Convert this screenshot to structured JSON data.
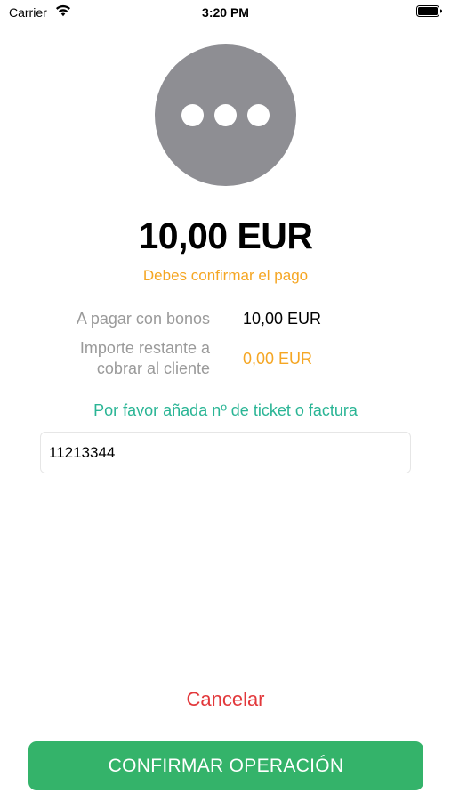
{
  "status_bar": {
    "carrier": "Carrier",
    "time": "3:20 PM",
    "icons": [
      "wifi-icon",
      "battery-icon"
    ]
  },
  "status_icon": {
    "name": "pending-icon",
    "color": "#8e8e93"
  },
  "payment": {
    "amount": "10,00 EUR",
    "warning": "Debes confirmar el pago",
    "rows": [
      {
        "label": "A pagar con bonos",
        "value": "10,00 EUR",
        "value_color": "#000000"
      },
      {
        "label_line1": "Importe restante a",
        "label_line2": "cobrar al cliente",
        "value": "0,00 EUR",
        "value_color": "#f5a623"
      }
    ]
  },
  "ticket": {
    "prompt": "Por favor añada nº de ticket o factura",
    "value": "11213344"
  },
  "actions": {
    "cancel_label": "Cancelar",
    "confirm_label": "CONFIRMAR OPERACIÓN"
  },
  "colors": {
    "warning": "#f5a623",
    "accent_teal": "#2ab595",
    "cancel_red": "#e2383b",
    "confirm_green": "#34b36a"
  }
}
